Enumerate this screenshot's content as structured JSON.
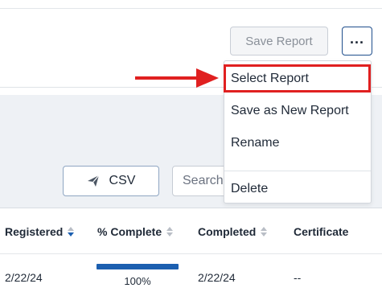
{
  "toolbar": {
    "save_report_label": "Save Report",
    "more_label": "..."
  },
  "menu": {
    "items": [
      "Select Report",
      "Save as New Report",
      "Rename",
      "Delete"
    ]
  },
  "actions": {
    "csv_label": "CSV",
    "search_placeholder": "Search"
  },
  "table": {
    "headers": [
      "Registered",
      "% Complete",
      "Completed",
      "Certificate"
    ],
    "rows": [
      {
        "registered": "2/22/24",
        "percent_complete": "100%",
        "completed": "2/22/24",
        "certificate": "--"
      }
    ]
  },
  "colors": {
    "accent": "#1c5fb0",
    "highlight": "#e02020"
  },
  "icons": [
    "send-icon",
    "sort-icon",
    "more-icon",
    "arrow-annotation"
  ]
}
